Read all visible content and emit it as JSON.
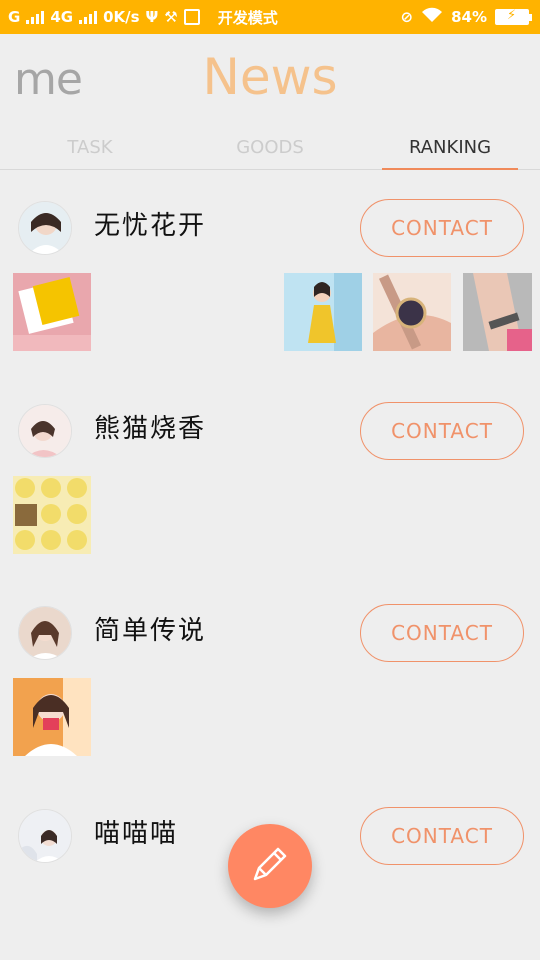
{
  "status_bar": {
    "carrier_left": "G",
    "network": "4G",
    "speed": "0K/s",
    "mode_text": "开发模式",
    "battery": "84%"
  },
  "header": {
    "logo_text": "me",
    "title": "News"
  },
  "tabs": [
    {
      "label": "TASK",
      "active": false
    },
    {
      "label": "GOODS",
      "active": false
    },
    {
      "label": "RANKING",
      "active": true
    }
  ],
  "posts": [
    {
      "name": "无忧花开",
      "contact_label": "CONTACT",
      "photo_count": 4
    },
    {
      "name": "熊猫烧香",
      "contact_label": "CONTACT",
      "photo_count": 1
    },
    {
      "name": "简单传说",
      "contact_label": "CONTACT",
      "photo_count": 1
    },
    {
      "name": "喵喵喵",
      "contact_label": "CONTACT",
      "photo_count": 0
    }
  ],
  "fab": {
    "icon": "pencil-icon"
  },
  "colors": {
    "status_bar": "#ffb300",
    "accent": "#f0926a",
    "title": "#f5c28c",
    "fab": "#ff8763"
  }
}
